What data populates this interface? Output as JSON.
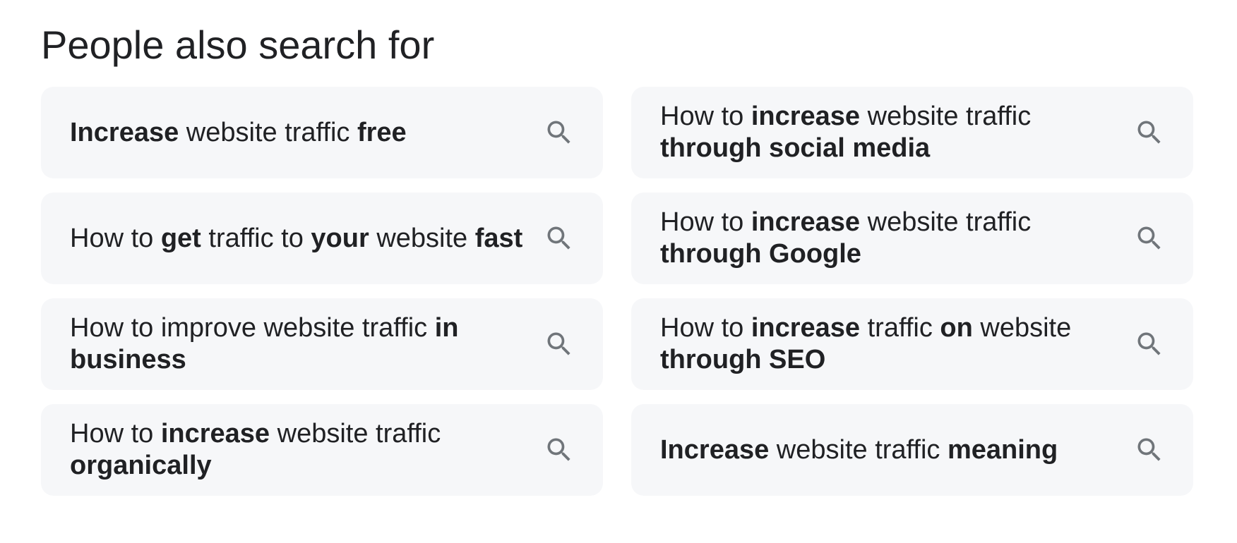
{
  "heading": "People also search for",
  "icon": "search-icon",
  "colors": {
    "card_background": "#f6f7f9",
    "text": "#202124",
    "icon": "#70757a"
  },
  "suggestions": [
    {
      "segments": [
        {
          "text": "Increase",
          "bold": true
        },
        {
          "text": " website traffic ",
          "bold": false
        },
        {
          "text": "free",
          "bold": true
        }
      ]
    },
    {
      "segments": [
        {
          "text": "How to ",
          "bold": false
        },
        {
          "text": "increase",
          "bold": true
        },
        {
          "text": " website traffic ",
          "bold": false
        },
        {
          "text": "through social media",
          "bold": true
        }
      ]
    },
    {
      "segments": [
        {
          "text": "How to ",
          "bold": false
        },
        {
          "text": "get",
          "bold": true
        },
        {
          "text": " traffic to ",
          "bold": false
        },
        {
          "text": "your",
          "bold": true
        },
        {
          "text": " website ",
          "bold": false
        },
        {
          "text": "fast",
          "bold": true
        }
      ]
    },
    {
      "segments": [
        {
          "text": "How to ",
          "bold": false
        },
        {
          "text": "increase",
          "bold": true
        },
        {
          "text": " website traffic ",
          "bold": false
        },
        {
          "text": "through Google",
          "bold": true
        }
      ]
    },
    {
      "segments": [
        {
          "text": "How to improve website traffic ",
          "bold": false
        },
        {
          "text": "in business",
          "bold": true
        }
      ]
    },
    {
      "segments": [
        {
          "text": "How to ",
          "bold": false
        },
        {
          "text": "increase",
          "bold": true
        },
        {
          "text": " traffic ",
          "bold": false
        },
        {
          "text": "on",
          "bold": true
        },
        {
          "text": " website ",
          "bold": false
        },
        {
          "text": "through SEO",
          "bold": true
        }
      ]
    },
    {
      "segments": [
        {
          "text": "How to ",
          "bold": false
        },
        {
          "text": "increase",
          "bold": true
        },
        {
          "text": " website traffic ",
          "bold": false
        },
        {
          "text": "organically",
          "bold": true
        }
      ]
    },
    {
      "segments": [
        {
          "text": "Increase",
          "bold": true
        },
        {
          "text": " website traffic ",
          "bold": false
        },
        {
          "text": "meaning",
          "bold": true
        }
      ]
    }
  ]
}
